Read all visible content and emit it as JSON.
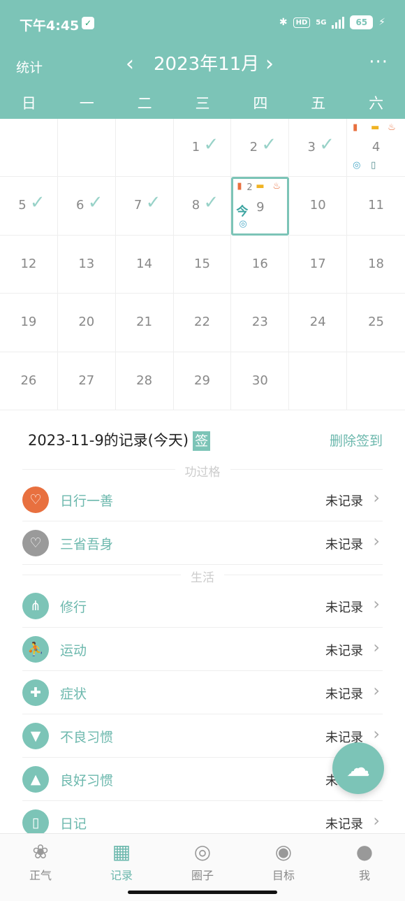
{
  "status_bar": {
    "time": "下午4:45",
    "hd": "HD",
    "net": "5G",
    "battery": "65"
  },
  "nav": {
    "stats_label": "统计",
    "prev": "‹",
    "month": "2023年11月",
    "next": "›",
    "more": "···"
  },
  "weekdays": [
    "日",
    "一",
    "二",
    "三",
    "四",
    "五",
    "六"
  ],
  "calendar": {
    "days": [
      {
        "n": "",
        "chk": false
      },
      {
        "n": "",
        "chk": false
      },
      {
        "n": "",
        "chk": false
      },
      {
        "n": "1",
        "chk": true
      },
      {
        "n": "2",
        "chk": true
      },
      {
        "n": "3",
        "chk": true
      },
      {
        "n": "4",
        "chk": false
      },
      {
        "n": "5",
        "chk": true
      },
      {
        "n": "6",
        "chk": true
      },
      {
        "n": "7",
        "chk": true
      },
      {
        "n": "8",
        "chk": true
      },
      {
        "n": "9",
        "chk": false
      },
      {
        "n": "10",
        "chk": false
      },
      {
        "n": "11",
        "chk": false
      },
      {
        "n": "12",
        "chk": false
      },
      {
        "n": "13",
        "chk": false
      },
      {
        "n": "14",
        "chk": false
      },
      {
        "n": "15",
        "chk": false
      },
      {
        "n": "16",
        "chk": false
      },
      {
        "n": "17",
        "chk": false
      },
      {
        "n": "18",
        "chk": false
      },
      {
        "n": "19",
        "chk": false
      },
      {
        "n": "20",
        "chk": false
      },
      {
        "n": "21",
        "chk": false
      },
      {
        "n": "22",
        "chk": false
      },
      {
        "n": "23",
        "chk": false
      },
      {
        "n": "24",
        "chk": false
      },
      {
        "n": "25",
        "chk": false
      },
      {
        "n": "26",
        "chk": false
      },
      {
        "n": "27",
        "chk": false
      },
      {
        "n": "28",
        "chk": false
      },
      {
        "n": "29",
        "chk": false
      },
      {
        "n": "30",
        "chk": false
      },
      {
        "n": "",
        "chk": false
      },
      {
        "n": "",
        "chk": false
      }
    ],
    "today_label": "今",
    "today_badge": "2"
  },
  "records": {
    "title": "2023-11-9的记录(今天)",
    "sign_badge": "签",
    "delete_label": "删除签到",
    "section_merit": "功过格",
    "section_life": "生活",
    "rows": [
      {
        "label": "日行一善",
        "value": "未记录",
        "icon": "heart-icon",
        "color": "#e8703f"
      },
      {
        "label": "三省吾身",
        "value": "未记录",
        "icon": "broken-heart-icon",
        "color": "#9a9a9a"
      },
      {
        "label": "修行",
        "value": "未记录",
        "icon": "roots-icon",
        "color": "#7cc4b7"
      },
      {
        "label": "运动",
        "value": "未记录",
        "icon": "runner-icon",
        "color": "#7cc4b7"
      },
      {
        "label": "症状",
        "value": "未记录",
        "icon": "medkit-icon",
        "color": "#7cc4b7"
      },
      {
        "label": "不良习惯",
        "value": "未记录",
        "icon": "thumbs-down-icon",
        "color": "#7cc4b7"
      },
      {
        "label": "良好习惯",
        "value": "未记录",
        "icon": "thumbs-up-icon",
        "color": "#7cc4b7"
      },
      {
        "label": "日记",
        "value": "未记录",
        "icon": "diary-icon",
        "color": "#7cc4b7"
      }
    ]
  },
  "tabs": [
    {
      "label": "正气",
      "icon": "lotus-icon"
    },
    {
      "label": "记录",
      "icon": "calendar-icon"
    },
    {
      "label": "圈子",
      "icon": "circle-icon"
    },
    {
      "label": "目标",
      "icon": "target-icon"
    },
    {
      "label": "我",
      "icon": "person-icon"
    }
  ],
  "colors": {
    "accent": "#7cc4b7",
    "accent_text": "#6cb8ad"
  }
}
